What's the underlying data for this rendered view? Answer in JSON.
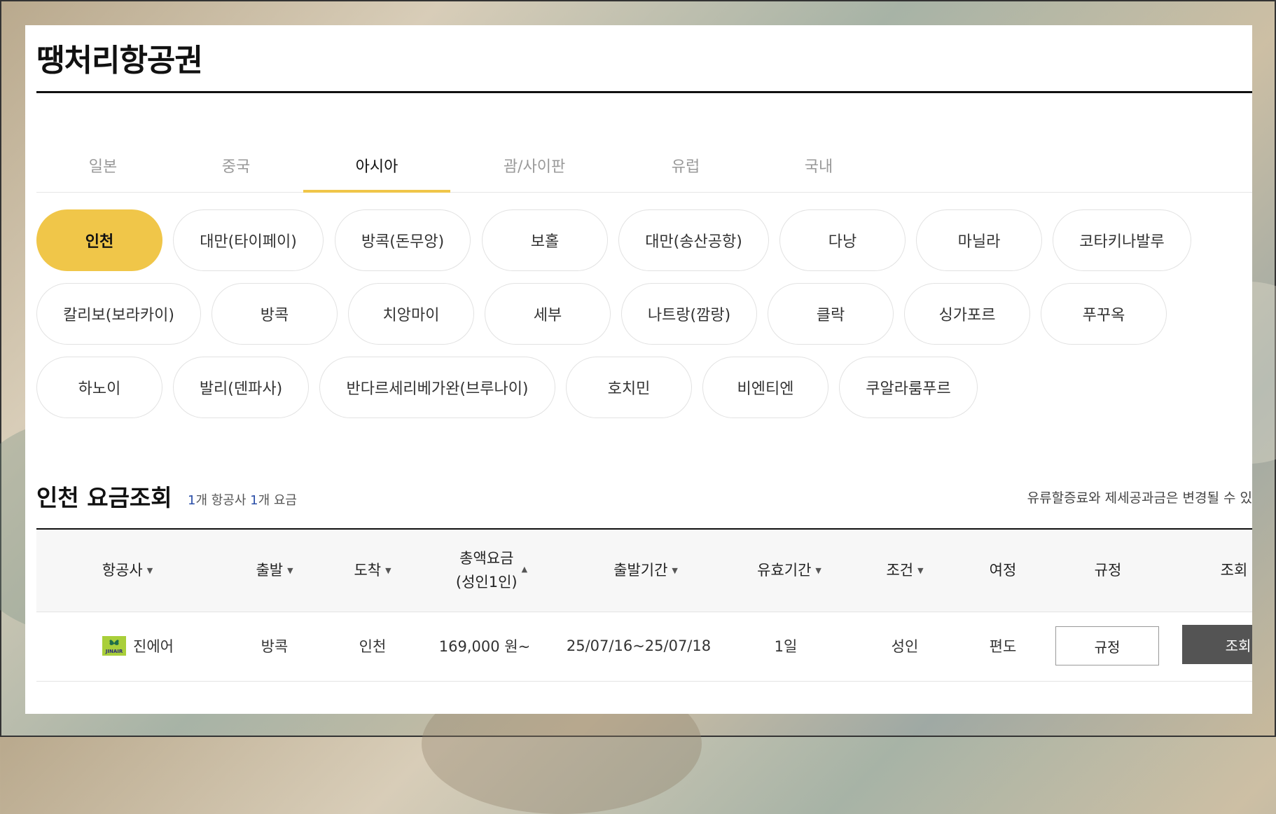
{
  "page": {
    "title": "땡처리항공권"
  },
  "tabs": [
    {
      "label": "일본",
      "active": false
    },
    {
      "label": "중국",
      "active": false
    },
    {
      "label": "아시아",
      "active": true
    },
    {
      "label": "괌/사이판",
      "active": false
    },
    {
      "label": "유럽",
      "active": false
    },
    {
      "label": "국내",
      "active": false
    }
  ],
  "cities": [
    "인천",
    "대만(타이페이)",
    "방콕(돈무앙)",
    "보홀",
    "대만(송산공항)",
    "다낭",
    "마닐라",
    "코타키나발루",
    "칼리보(보라카이)",
    "방콕",
    "치앙마이",
    "세부",
    "나트랑(깜랑)",
    "클락",
    "싱가포르",
    "푸꾸옥",
    "하노이",
    "발리(덴파사)",
    "반다르세리베가완(브루나이)",
    "호치민",
    "비엔티엔",
    "쿠알라룸푸르"
  ],
  "selected_city": "인천",
  "section": {
    "title": "인천 요금조회",
    "airline_count": "1",
    "airline_suffix": "개 항공사 ",
    "fare_count": "1",
    "fare_suffix": "개 요금",
    "notice": "유류할증료와 제세공과금은 변경될 수 있"
  },
  "table": {
    "headers": {
      "airline": "항공사",
      "departure": "출발",
      "arrival": "도착",
      "total_fare_line1": "총액요금",
      "total_fare_line2": "(성인1인)",
      "period": "출발기간",
      "validity": "유효기간",
      "condition": "조건",
      "itinerary": "여정",
      "rules": "규정",
      "search": "조회"
    },
    "rows": [
      {
        "airline": "진에어",
        "airline_logo_text": "JINAIR",
        "departure": "방콕",
        "arrival": "인천",
        "fare": "169,000 원~",
        "period": "25/07/16~25/07/18",
        "validity": "1일",
        "condition": "성인",
        "itinerary": "편도",
        "rules_button": "규정",
        "search_button": "조회"
      }
    ]
  },
  "colors": {
    "accent": "#f0c649",
    "dark_button": "#545454",
    "count_blue": "#2b4fa8"
  }
}
